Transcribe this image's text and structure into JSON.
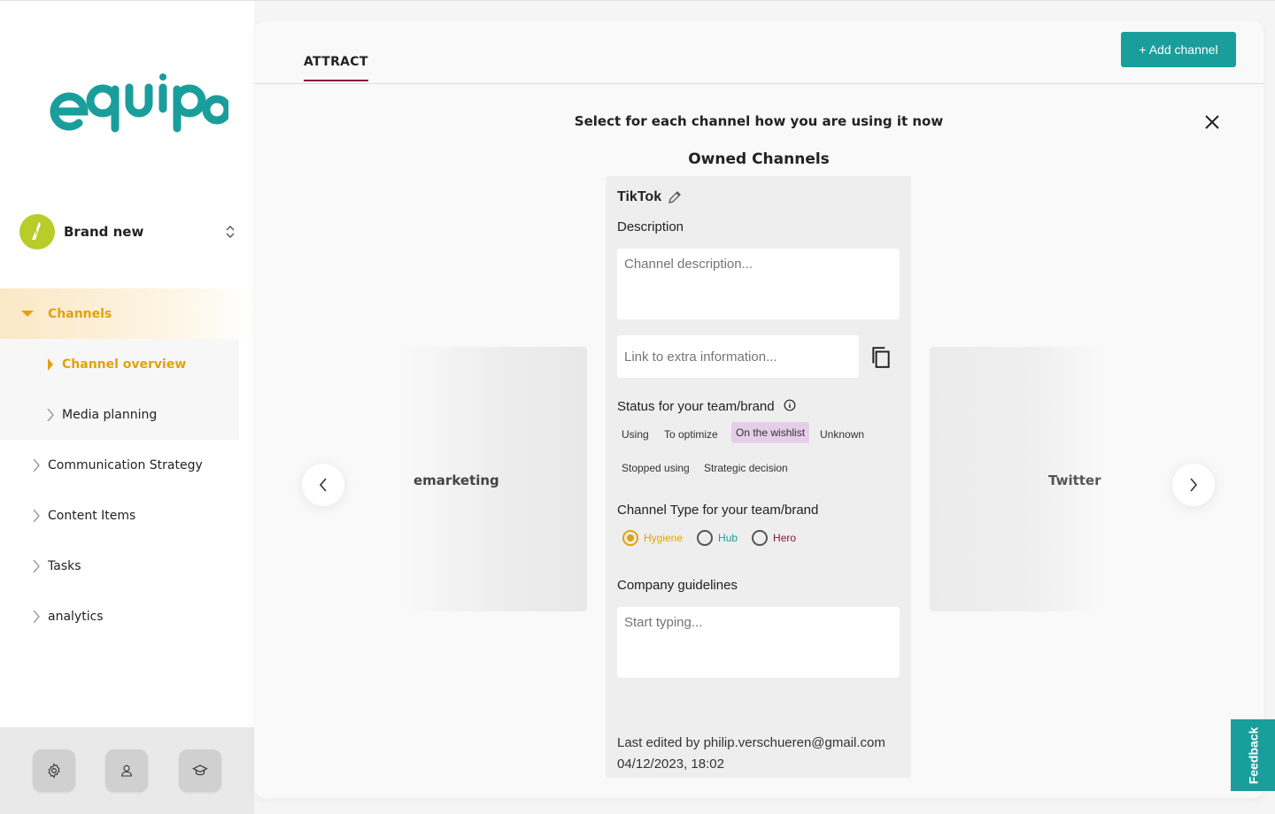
{
  "sidebar": {
    "brand": {
      "name": "Brand new"
    },
    "nav": {
      "channels": "Channels",
      "channel_overview": "Channel overview",
      "media_planning": "Media planning",
      "communication_strategy": "Communication Strategy",
      "content_items": "Content Items",
      "tasks": "Tasks",
      "analytics": "analytics"
    }
  },
  "main": {
    "tab": "ATTRACT",
    "add_channel_label": "+ Add channel",
    "heading": "Select for each channel how you are using it now",
    "subheading": "Owned Channels",
    "prev_channel": "emarketing",
    "next_channel": "Twitter",
    "card": {
      "title": "TikTok",
      "description_label": "Description",
      "description_placeholder": "Channel description...",
      "link_placeholder": "Link to extra information...",
      "status_label": "Status for your team/brand",
      "status_options": [
        "Using",
        "To optimize",
        "On the wishlist",
        "Unknown",
        "Stopped using",
        "Strategic decision"
      ],
      "status_selected": "On the wishlist",
      "type_label": "Channel Type for your team/brand",
      "type_options": [
        "Hygiene",
        "Hub",
        "Hero"
      ],
      "type_selected": "Hygiene",
      "guidelines_label": "Company guidelines",
      "guidelines_placeholder": "Start typing...",
      "last_edited": "Last edited by philip.verschueren@gmail.com",
      "last_edited_date": "04/12/2023, 18:02"
    }
  },
  "feedback_label": "Feedback",
  "colors": {
    "teal": "#1a9e9c",
    "accent_orange": "#e2a20c",
    "tab_underline": "#8a1538",
    "hub_teal": "#1a9e9c",
    "hero_maroon": "#8a1538",
    "selected_chip": "#e6cdea"
  },
  "icons": [
    "settings-gear-icon",
    "user-icon",
    "graduation-cap-icon",
    "pencil-icon",
    "copy-icon",
    "info-icon",
    "close-icon",
    "chevron-left-icon",
    "chevron-right-icon"
  ]
}
